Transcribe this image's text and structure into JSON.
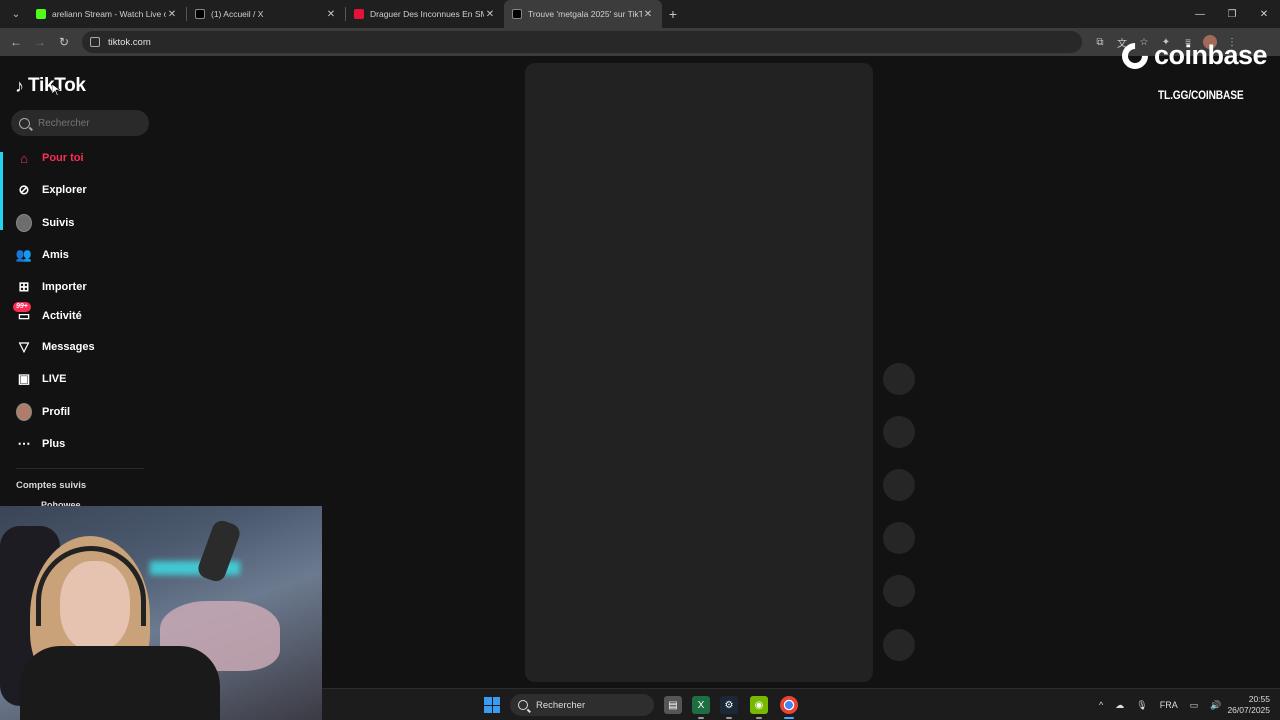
{
  "browser": {
    "tabs": [
      {
        "title": "areliann Stream - Watch Live on",
        "favicon_color": "#53fc18",
        "active": false
      },
      {
        "title": "(1) Accueil / X",
        "favicon_color": "#000000",
        "active": false
      },
      {
        "title": "Draguer Des Inconnues En SM",
        "favicon_color": "#e5133c",
        "active": false
      },
      {
        "title": "Trouve 'metgala 2025' sur TikTo",
        "favicon_color": "#000000",
        "active": true
      }
    ],
    "url": "tiktok.com"
  },
  "tiktok": {
    "logo": "TikTok",
    "search_placeholder": "Rechercher",
    "nav": [
      {
        "label": "Pour toi",
        "icon": "home-icon",
        "active": true
      },
      {
        "label": "Explorer",
        "icon": "compass-icon",
        "active": false
      },
      {
        "label": "Suivis",
        "icon": "avatar-icon",
        "active": false
      },
      {
        "label": "Amis",
        "icon": "friends-icon",
        "active": false
      },
      {
        "label": "Importer",
        "icon": "upload-icon",
        "active": false
      },
      {
        "label": "Activité",
        "icon": "inbox-icon",
        "active": false,
        "badge": "99+"
      },
      {
        "label": "Messages",
        "icon": "send-icon",
        "active": false
      },
      {
        "label": "LIVE",
        "icon": "live-tv-icon",
        "active": false
      },
      {
        "label": "Profil",
        "icon": "profile-avatar-icon",
        "active": false
      },
      {
        "label": "Plus",
        "icon": "more-icon",
        "active": false
      }
    ],
    "followed_title": "Comptes suivis",
    "followed_first": "Pohowee"
  },
  "overlay": {
    "brand": "coinbase",
    "link": "TL.GG/COINBASE"
  },
  "taskbar": {
    "search_label": "Rechercher",
    "language": "FRA",
    "time": "20:55",
    "date": "26/07/2025"
  },
  "colors": {
    "accent": "#fe2c55",
    "nav_indicator": "#20d5ec",
    "background": "#121212"
  }
}
